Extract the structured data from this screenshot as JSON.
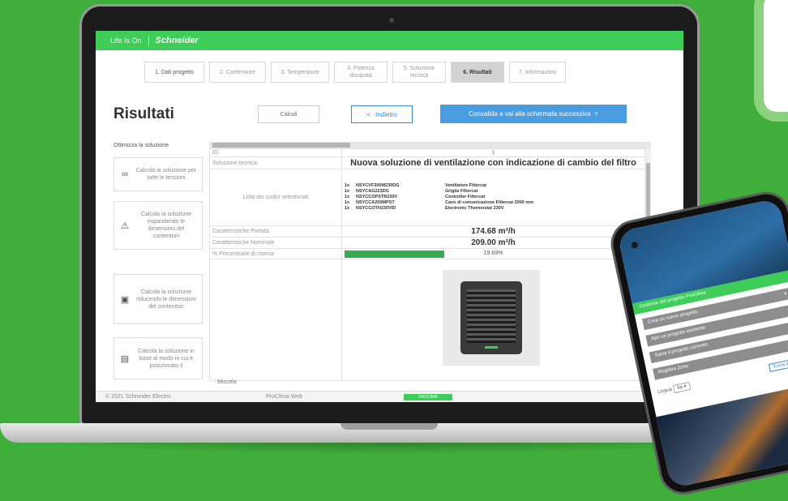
{
  "header": {
    "life_is_on": "Life Is On",
    "brand": "Schneider"
  },
  "steps": [
    {
      "label": "1. Dati progetto",
      "state": "done"
    },
    {
      "label": "2. Contenitore",
      "state": "todo"
    },
    {
      "label": "3. Temperature",
      "state": "todo"
    },
    {
      "label": "4. Potenza dissipata",
      "state": "todo"
    },
    {
      "label": "5. Soluzione tecnica",
      "state": "todo"
    },
    {
      "label": "6. Risultati",
      "state": "active"
    },
    {
      "label": "7. Informazioni",
      "state": "todo"
    }
  ],
  "page": {
    "title": "Risultati",
    "calcoli_label": "Calcoli",
    "indietro_label": "Indietro",
    "convalida_label": "Convalida e vai alla schermata successiva"
  },
  "sidebar": {
    "title": "Ottimizza la soluzione",
    "options": [
      {
        "icon": "link-icon",
        "glyph": "∞",
        "text": "Calcola la soluzione per tutte le tensioni"
      },
      {
        "icon": "warning-icon",
        "glyph": "⚠",
        "text": "Calcola la soluzione espandendo le dimensioni del contenitori"
      },
      {
        "icon": "cabinet-icon",
        "glyph": "▣",
        "text": "Calcola la soluzione riducendo le dimensioni del contenitori"
      },
      {
        "icon": "document-icon",
        "glyph": "▤",
        "text": "Calcola la soluzione in base al modo in cui è posizionato il"
      }
    ]
  },
  "results": {
    "id_label": "ID",
    "id_value": "1",
    "solution_label": "Soluzione tecnica",
    "solution_value": "Nuova soluzione di ventilazione con indicazione di cambio del filtro",
    "components_label": "Lista dei codici selezionati",
    "components": [
      {
        "qty": "1x",
        "code": "NSYCVF300M230DG",
        "desc": "Ventilatore Filtercat"
      },
      {
        "qty": "1x",
        "code": "NSYCAG223DG",
        "desc": "Griglia Filtercat"
      },
      {
        "qty": "1x",
        "code": "NSYCCOPSTR230V",
        "desc": "Controller Filtercat"
      },
      {
        "qty": "1x",
        "code": "NSYCCA200MPST",
        "desc": "Cavo di comunicazione Filtercat 2000 mm"
      },
      {
        "qty": "1x",
        "code": "NSYCCOTH230VID",
        "desc": "Electronic Thermostat 230V"
      }
    ],
    "flow_label": "Caratteristiche Portata",
    "flow_value": "174.68 m³/h",
    "nominal_label": "Caratteristiche Nominale",
    "nominal_value": "209.00 m³/h",
    "reserve_label": "% Percentuale di riserva",
    "reserve_value": "19.69%",
    "reserve_fraction": 0.1969,
    "misc_label": "Miscela"
  },
  "footer": {
    "copyright": "© 2021 Schneider Electric",
    "app": "ProClima Web",
    "badge": "PROCIMA"
  },
  "phone": {
    "bar_title": "Gestione del progetto ProClima",
    "buttons": [
      "Crea un nuovo progetto",
      "Apri un progetto esistente",
      "Salva il progetto corrente",
      "Registra Zone"
    ],
    "lang_label": "Lingua",
    "lang_value": "Ita",
    "link_label": "Torna indietro"
  },
  "colors": {
    "brand_green": "#3dcd58",
    "accent_blue": "#4a9de0",
    "bg_green": "#3fae3a"
  }
}
